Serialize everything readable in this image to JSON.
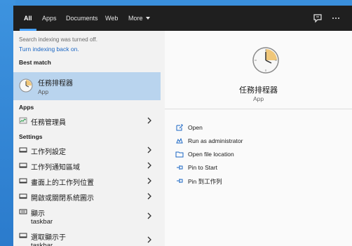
{
  "tabs": [
    {
      "label": "All"
    },
    {
      "label": "Apps"
    },
    {
      "label": "Documents"
    },
    {
      "label": "Web"
    },
    {
      "label": "More"
    }
  ],
  "top_icons": [
    "feedback-icon",
    "more-options-icon"
  ],
  "notice": {
    "text": "Search indexing was turned off.",
    "link": "Turn indexing back on."
  },
  "sections": {
    "best_match": "Best match",
    "apps": "Apps",
    "settings": "Settings"
  },
  "best_match": {
    "title": "任務排程器",
    "subtitle": "App"
  },
  "apps": [
    {
      "label": "任務管理員"
    }
  ],
  "settings": [
    {
      "label": "工作列設定"
    },
    {
      "label": "工作列通知區域"
    },
    {
      "label": "畫面上的工作列位置"
    },
    {
      "label": "開啟或關閉系統圖示"
    },
    {
      "label": "顯示",
      "sub": "taskbar"
    },
    {
      "label": "選取顯示于",
      "sub": "taskbar"
    }
  ],
  "detail": {
    "title": "任務排程器",
    "kind": "App",
    "actions": [
      {
        "label": "Open",
        "icon": "open-icon"
      },
      {
        "label": "Run as administrator",
        "icon": "admin-icon"
      },
      {
        "label": "Open file location",
        "icon": "folder-icon"
      },
      {
        "label": "Pin to Start",
        "icon": "pin-icon"
      },
      {
        "label": "Pin 到工作列",
        "icon": "pin-icon"
      }
    ]
  },
  "colors": {
    "accent": "#1a66c4",
    "selected": "#b9d4ee",
    "topbar": "#1f1f1f"
  }
}
